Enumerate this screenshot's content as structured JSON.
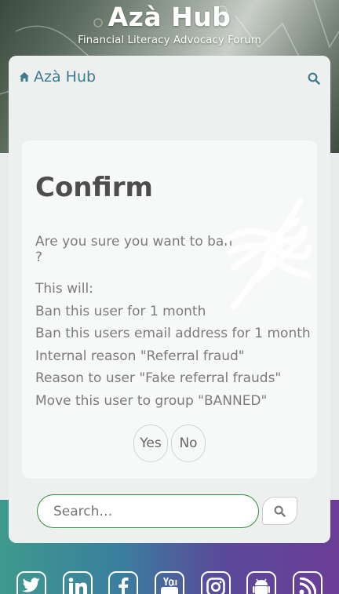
{
  "header": {
    "site_title": "Azà Hub",
    "site_desc": "Financial Literacy Advocacy Forum"
  },
  "navbar": {
    "brand_label": "Azà Hub",
    "home_icon": "home-icon",
    "search_icon": "search-icon"
  },
  "confirm": {
    "title": "Confirm",
    "question": "Are you sure you want to ban",
    "question_end": "?",
    "intro": "This will:",
    "items": [
      "Ban this user for 1 month",
      "Ban this users email address for 1 month",
      "Internal reason \"Referral fraud\"",
      "Reason to user \"Fake referral frauds\"",
      "Move this user to group \"BANNED\""
    ],
    "yes_label": "Yes",
    "no_label": "No"
  },
  "search": {
    "placeholder": "Search…"
  },
  "social": [
    "twitter-icon",
    "linkedin-icon",
    "facebook-icon",
    "youtube-icon",
    "instagram-icon",
    "android-icon",
    "rss-icon"
  ],
  "colors": {
    "brand": "#3b7b8c",
    "search_border": "#2e8f3e",
    "footer_start": "#3e9a8c",
    "footer_end": "#6b3d97"
  }
}
